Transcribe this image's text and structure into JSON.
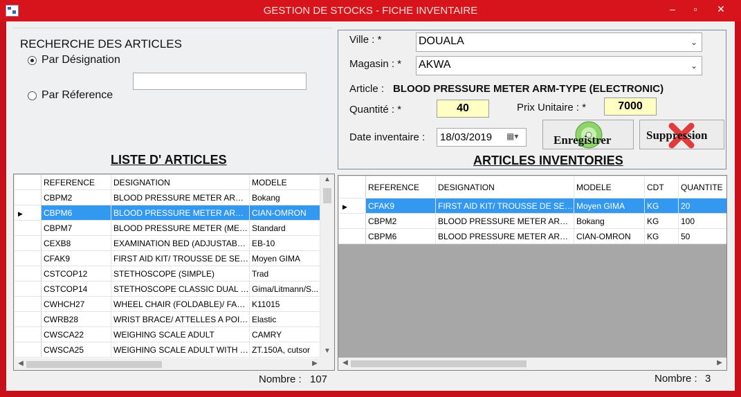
{
  "window": {
    "title": "GESTION DE STOCKS - FICHE INVENTAIRE",
    "min": "–",
    "max": "▫",
    "close": "✕"
  },
  "search": {
    "title": "RECHERCHE DES ARTICLES",
    "option_designation": "Par Désignation",
    "option_reference": "Par Réference",
    "selected": "designation",
    "input_value": ""
  },
  "form": {
    "ville_label": "Ville : *",
    "ville_value": "DOUALA",
    "magasin_label": "Magasin : *",
    "magasin_value": "AKWA",
    "article_label": "Article :",
    "article_value": "BLOOD PRESSURE METER ARM-TYPE (ELECTRONIC)",
    "quantite_label": "Quantité : *",
    "quantite_value": "40",
    "prix_label": "Prix Unitaire : *",
    "prix_value": "7000",
    "date_label": "Date inventaire :",
    "date_value": "18/03/2019",
    "save_label": "Enregistrer",
    "delete_label": "Suppression"
  },
  "articles": {
    "header": "LISTE D' ARTICLES",
    "columns": [
      "REFERENCE",
      "DESIGNATION",
      "MODELE"
    ],
    "rows": [
      [
        "CBPM2",
        "BLOOD PRESSURE METER ARM-T...",
        "Bokang"
      ],
      [
        "CBPM6",
        "BLOOD PRESSURE METER ARM-T...",
        "CIAN-OMRON"
      ],
      [
        "CBPM7",
        "BLOOD PRESSURE METER (MERC...",
        "Standard"
      ],
      [
        "CEXB8",
        "EXAMINATION BED (ADJUSTABLE ...",
        "EB-10"
      ],
      [
        "CFAK9",
        "FIRST AID KIT/ TROUSSE DE SECO...",
        "Moyen GIMA"
      ],
      [
        "CSTCOP12",
        "STETHOSCOPE (SIMPLE)",
        "Trad"
      ],
      [
        "CSTCOP14",
        "STETHOSCOPE  CLASSIC DUAL HE...",
        "Gima/Litmann/S..."
      ],
      [
        "CWHCH27",
        "WHEEL CHAIR (FOLDABLE)/ FAUTE...",
        "K11015"
      ],
      [
        "CWRB28",
        "WRIST BRACE/ ATTELLES A POIGNÉ",
        "Elastic"
      ],
      [
        "CWSCA22",
        "WEIGHING SCALE ADULT",
        "CAMRY"
      ],
      [
        "CWSCA25",
        "WEIGHING SCALE ADULT WITH RU...",
        "ZT.150A, cutsor"
      ]
    ],
    "selected_index": 1,
    "count_label": "Nombre :",
    "count_value": "107"
  },
  "inventory": {
    "header": "ARTICLES INVENTORIES",
    "columns": [
      "REFERENCE",
      "DESIGNATION",
      "MODELE",
      "CDT",
      "QUANTITE"
    ],
    "rows": [
      [
        "CFAK9",
        "FIRST AID KIT/ TROUSSE DE SECO...",
        "Moyen GIMA",
        "KG",
        "20"
      ],
      [
        "CBPM2",
        "BLOOD PRESSURE METER ARM-T...",
        "Bokang",
        "KG",
        "100"
      ],
      [
        "CBPM6",
        "BLOOD PRESSURE METER ARM-T...",
        "CIAN-OMRON",
        "KG",
        "50"
      ]
    ],
    "selected_index": 0,
    "count_label": "Nombre :",
    "count_value": "3"
  },
  "colors": {
    "frame": "#d7141c",
    "selection": "#3399f0",
    "yellow_field": "#ffffc4"
  }
}
